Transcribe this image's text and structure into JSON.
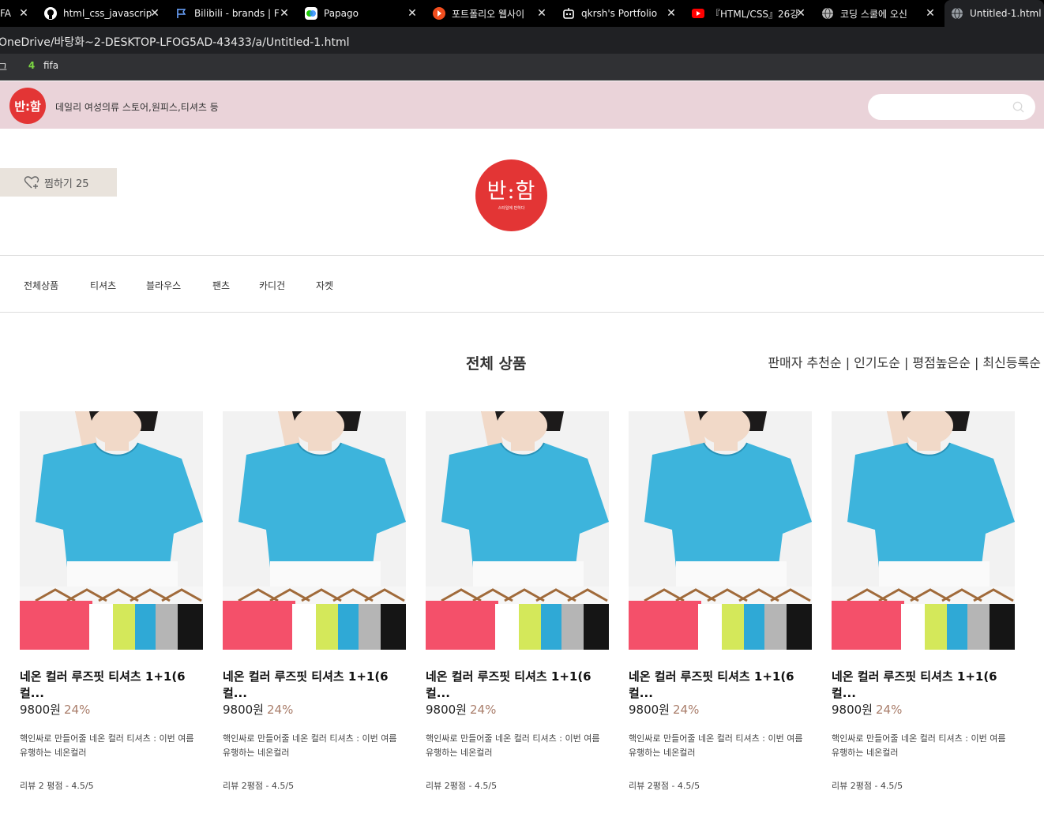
{
  "browser": {
    "tabs": [
      {
        "title": "FA",
        "icon": "generic-favicon-icon"
      },
      {
        "title": "html_css_javascrip",
        "icon": "github-icon"
      },
      {
        "title": "Bilibili - brands | F",
        "icon": "flag-icon"
      },
      {
        "title": "Papago",
        "icon": "papago-icon"
      },
      {
        "title": "포트폴리오 웹사이",
        "icon": "figma-red-icon"
      },
      {
        "title": "qkrsh's Portfolio",
        "icon": "robot-icon"
      },
      {
        "title": "『HTML/CSS』26강",
        "icon": "youtube-icon"
      },
      {
        "title": "코딩 스쿨에 오신",
        "icon": "globe-icon"
      },
      {
        "title": "Untitled-1.html",
        "icon": "globe-icon"
      }
    ],
    "url": "OneDrive/바탕화~2-DESKTOP-LFOG5AD-43433/a/Untitled-1.html",
    "bookmarks": [
      {
        "label": "그"
      },
      {
        "label": "fifa",
        "icon_text": "4"
      }
    ]
  },
  "banner": {
    "logo_text": "반:함",
    "tagline": "데일리 여성의류 스토어,원피스,티셔츠 등",
    "search_placeholder": ""
  },
  "header": {
    "wishlist_label": "찜하기 25",
    "logo_text": "반:함",
    "logo_sub": "스타일에 반하다"
  },
  "nav": {
    "categories": [
      "전체상품",
      "티셔츠",
      "블라우스",
      "팬츠",
      "카디건",
      "자켓"
    ]
  },
  "main": {
    "section_title": "전체 상품",
    "sort_options": [
      "판매자 추천순",
      "인기도순",
      "평점높은순",
      "최신등록순"
    ],
    "products": [
      {
        "name": "네온 컬러 루즈핏 티셔츠 1+1(6 컬...",
        "price": "9800원",
        "discount": "24%",
        "desc": "핵인싸로 만들어줄 네온 컬러 티셔츠 : 이번 여름 유행하는 네온컬러",
        "review": "리뷰 2 평점 - 4.5/5"
      },
      {
        "name": "네온 컬러 루즈핏 티셔츠 1+1(6 컬...",
        "price": "9800원",
        "discount": "24%",
        "desc": "핵인싸로 만들어줄 네온 컬러 티셔츠 : 이번 여름 유행하는 네온컬러",
        "review": "리뷰 2평점 - 4.5/5"
      },
      {
        "name": "네온 컬러 루즈핏 티셔츠 1+1(6 컬...",
        "price": "9800원",
        "discount": "24%",
        "desc": "핵인싸로 만들어줄 네온 컬러 티셔츠 : 이번 여름 유행하는 네온컬러",
        "review": "리뷰 2평점 - 4.5/5"
      },
      {
        "name": "네온 컬러 루즈핏 티셔츠 1+1(6 컬...",
        "price": "9800원",
        "discount": "24%",
        "desc": "핵인싸로 만들어줄 네온 컬러 티셔츠 : 이번 여름 유행하는 네온컬러",
        "review": "리뷰 2평점 - 4.5/5"
      },
      {
        "name": "네온 컬러 루즈핏 티셔츠 1+1(6 컬...",
        "price": "9800원",
        "discount": "24%",
        "desc": "핵인싸로 만들어줄 네온 컬러 티셔츠 : 이번 여름 유행하는 네온컬러",
        "review": "리뷰 2평점 - 4.5/5"
      }
    ]
  },
  "colors": {
    "brand_red": "#e33535",
    "banner_pink": "#ead3d9",
    "wish_bg": "#e9e3dc",
    "discount": "#a97d6a",
    "shirt_blue": "#3db4dc"
  }
}
